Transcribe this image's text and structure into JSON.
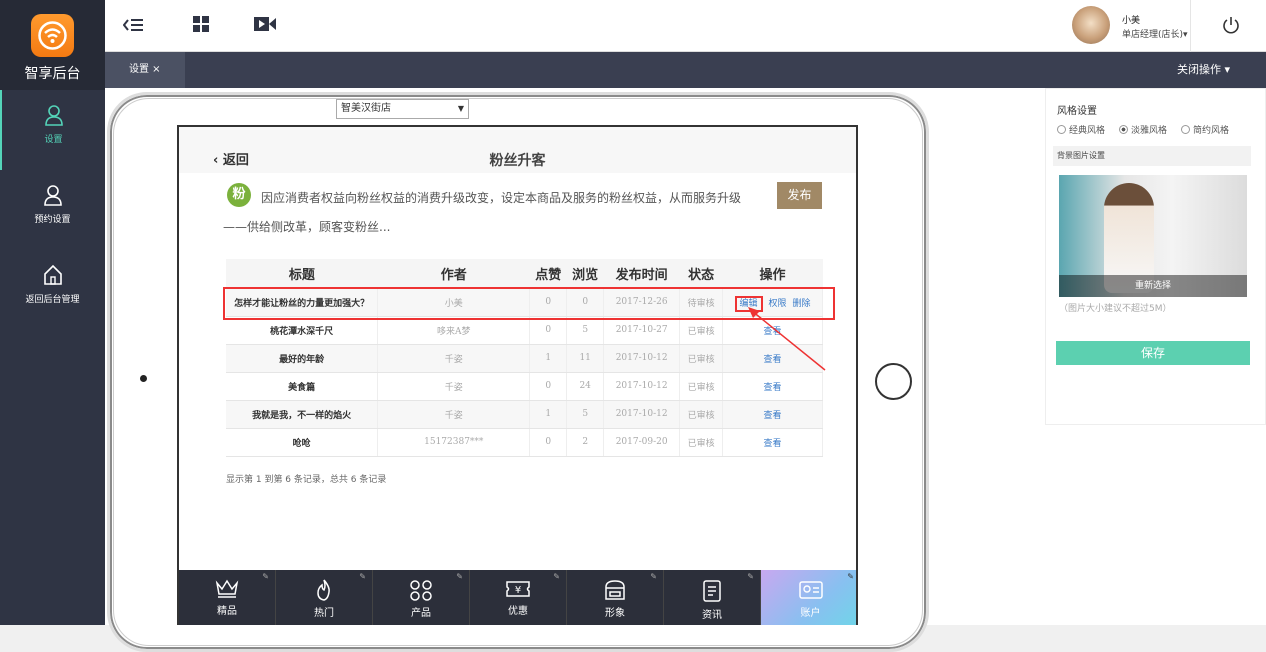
{
  "app": {
    "logo_text": "智享后台"
  },
  "sidebar": {
    "items": [
      {
        "label": "设置",
        "icon": "user-icon"
      },
      {
        "label": "预约设置",
        "icon": "user-icon"
      },
      {
        "label": "返回后台管理",
        "icon": "home-icon"
      }
    ]
  },
  "topbar": {
    "user_name": "小美",
    "user_role": "单店经理(店长)▾"
  },
  "tabs": {
    "settings": "设置 ×",
    "close_ops": "关闭操作 ▾"
  },
  "store_select": {
    "value": "智美汉街店"
  },
  "screen": {
    "back": "返回",
    "title": "粉丝升客",
    "badge": "粉",
    "intro": "因应消费者权益向粉丝权益的消费升级改变，设定本商品及服务的粉丝权益，从而服务升级——供给侧改革，顾客变粉丝...",
    "publish": "发布"
  },
  "table": {
    "headers": [
      "标题",
      "作者",
      "点赞",
      "浏览",
      "发布时间",
      "状态",
      "操作"
    ],
    "rows": [
      {
        "title": "怎样才能让粉丝的力量更加强大？",
        "author": "小美",
        "likes": "0",
        "views": "0",
        "date": "2017-12-26",
        "status": "待审核",
        "ops": [
          "编辑",
          "权限",
          "删除"
        ]
      },
      {
        "title": "桃花潭水深千尺",
        "author": "哆来A梦",
        "likes": "0",
        "views": "5",
        "date": "2017-10-27",
        "status": "已审核",
        "ops": [
          "查看"
        ]
      },
      {
        "title": "最好的年龄",
        "author": "千姿",
        "likes": "1",
        "views": "11",
        "date": "2017-10-12",
        "status": "已审核",
        "ops": [
          "查看"
        ]
      },
      {
        "title": "美食篇",
        "author": "千姿",
        "likes": "0",
        "views": "24",
        "date": "2017-10-12",
        "status": "已审核",
        "ops": [
          "查看"
        ]
      },
      {
        "title": "我就是我，不一样的焰火",
        "author": "千姿",
        "likes": "1",
        "views": "5",
        "date": "2017-10-12",
        "status": "已审核",
        "ops": [
          "查看"
        ]
      },
      {
        "title": "呛呛",
        "author": "15172387***",
        "likes": "0",
        "views": "2",
        "date": "2017-09-20",
        "status": "已审核",
        "ops": [
          "查看"
        ]
      }
    ],
    "record": "显示第 1 到第 6 条记录，总共 6 条记录"
  },
  "bottom_nav": [
    {
      "label": "精品",
      "icon": "crown-icon"
    },
    {
      "label": "热门",
      "icon": "flame-icon"
    },
    {
      "label": "产品",
      "icon": "grid-icon"
    },
    {
      "label": "优惠",
      "icon": "coupon-icon"
    },
    {
      "label": "形象",
      "icon": "store-icon"
    },
    {
      "label": "资讯",
      "icon": "news-icon"
    },
    {
      "label": "账户",
      "icon": "id-card-icon"
    }
  ],
  "style_panel": {
    "title": "风格设置",
    "options": [
      "经典风格",
      "淡雅风格",
      "简约风格"
    ],
    "selected": "淡雅风格",
    "bg_label": "背景图片设置",
    "reselect": "重新选择",
    "note": "（图片大小建议不超过5M）",
    "save": "保存"
  },
  "colors": {
    "sidebar": "#2f3444",
    "accent": "#54d4b9",
    "publish": "#a18966",
    "save": "#5cd0b0",
    "highlight": "#e33333"
  }
}
